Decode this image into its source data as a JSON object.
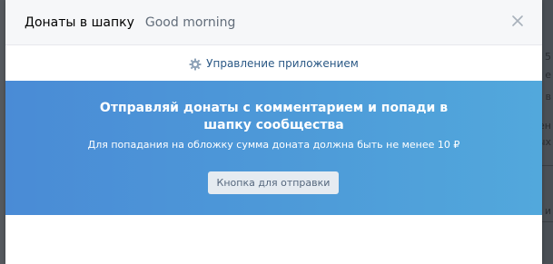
{
  "modal": {
    "title": "Донаты в шапку",
    "subtitle": "Good morning",
    "close_icon": "close-icon"
  },
  "manage": {
    "icon": "gear-icon",
    "label": "Управление приложением"
  },
  "banner": {
    "title": "Отправляй донаты с комментарием и попади в шапку сообщества",
    "description": "Для попадания на обложку сумма доната должна быть не менее 10 ₽",
    "button_label": "Кнопка для отправки"
  },
  "background": {
    "snippets": [
      "5",
      "е",
      "в",
      "ен",
      "ых",
      "и"
    ]
  },
  "colors": {
    "header_bg": "#f6f7f9",
    "link": "#2a5885",
    "banner_start": "#4a8bd6",
    "banner_end": "#52a8dc",
    "button_bg": "#e5ebf1",
    "button_text": "#55677d"
  }
}
